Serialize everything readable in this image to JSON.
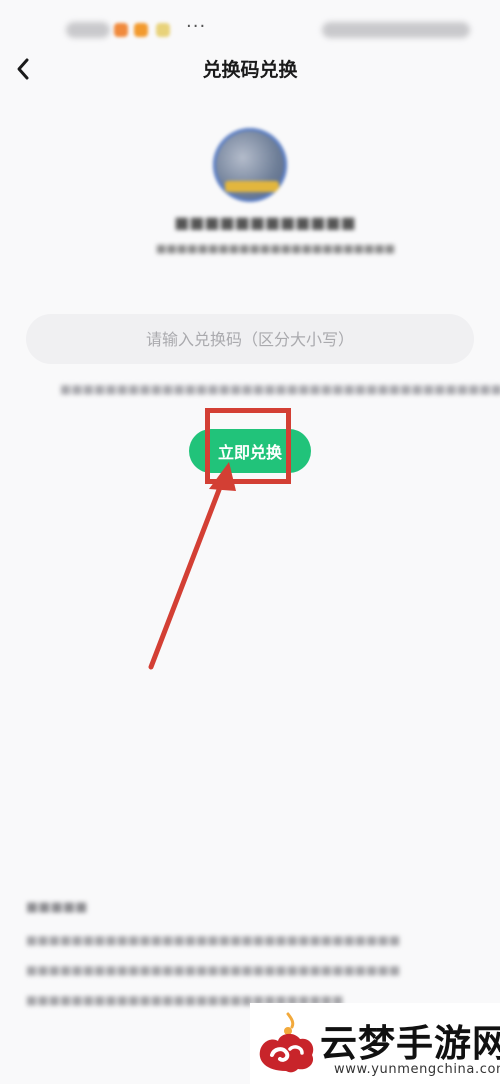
{
  "nav": {
    "title": "兑换码兑换",
    "back_icon": "chevron-left-icon"
  },
  "status_bar": {
    "more": "···"
  },
  "redeem": {
    "input_placeholder": "请输入兑换码（区分大小写）",
    "input_value": "",
    "submit_label": "立即兑换"
  },
  "watermark": {
    "name": "云梦手游网",
    "url": "www.yunmengchina.com"
  },
  "colors": {
    "accent": "#21c37a",
    "annotation": "#d33f34",
    "background": "#f9f9fa"
  }
}
